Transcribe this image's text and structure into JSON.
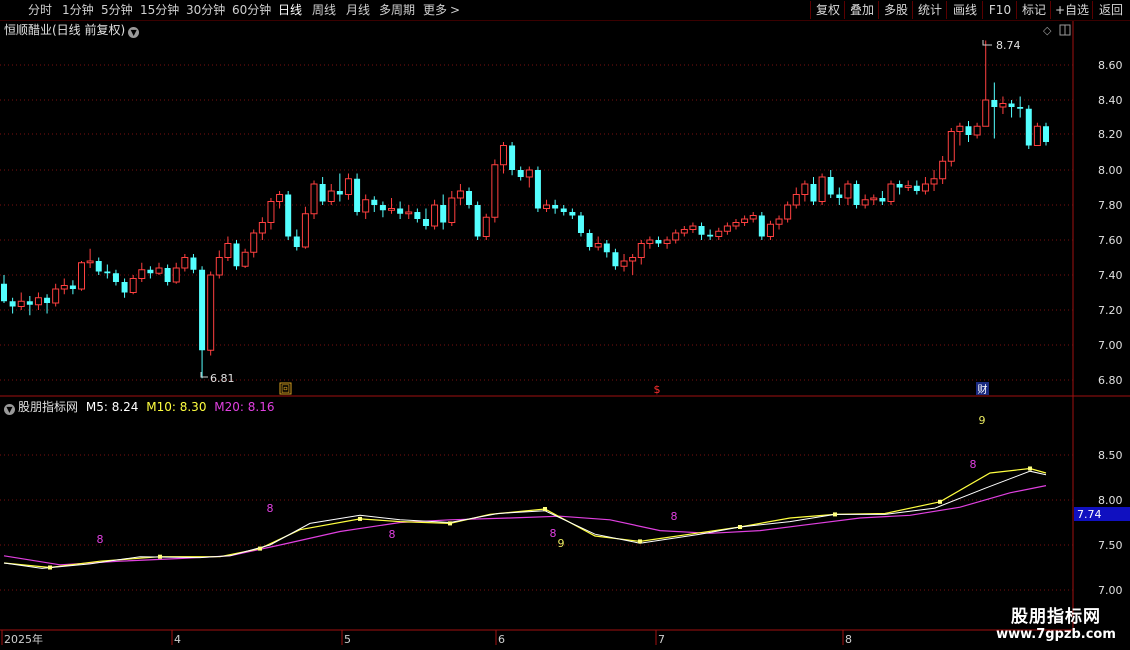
{
  "toolbar": {
    "periods": [
      "分时",
      "1分钟",
      "5分钟",
      "15分钟",
      "30分钟",
      "60分钟",
      "日线",
      "周线",
      "月线",
      "多周期",
      "更多"
    ],
    "selected": "日线",
    "right_buttons": [
      "复权",
      "叠加",
      "多股",
      "统计",
      "画线",
      "F10",
      "标记",
      "+自选",
      "返回"
    ]
  },
  "main_chart": {
    "title": "恒顺醋业(日线 前复权)",
    "y_ticks": [
      "8.60",
      "8.40",
      "8.20",
      "8.00",
      "7.80",
      "7.60",
      "7.40",
      "7.20",
      "7.00",
      "6.80"
    ],
    "high_label": "8.74",
    "low_label": "6.81",
    "markers": [
      "回",
      "$",
      "财"
    ]
  },
  "indicator": {
    "name": "股朋指标网",
    "m5_label": "M5: 8.24",
    "m10_label": "M10: 8.30",
    "m20_label": "M20: 8.16",
    "y_ticks": [
      "8.50",
      "8.00",
      "7.50",
      "7.00"
    ],
    "current_value": "7.74",
    "signals": [
      {
        "text": "8",
        "color": "#e040e0",
        "x": 100,
        "y": 543
      },
      {
        "text": "8",
        "color": "#e040e0",
        "x": 270,
        "y": 512
      },
      {
        "text": "8",
        "color": "#e040e0",
        "x": 392,
        "y": 538
      },
      {
        "text": "8",
        "color": "#e040e0",
        "x": 553,
        "y": 537
      },
      {
        "text": "9",
        "color": "#e8e860",
        "x": 561,
        "y": 547
      },
      {
        "text": "8",
        "color": "#e040e0",
        "x": 674,
        "y": 520
      },
      {
        "text": "8",
        "color": "#e040e0",
        "x": 973,
        "y": 468
      },
      {
        "text": "9",
        "color": "#e8e860",
        "x": 982,
        "y": 424
      }
    ]
  },
  "time_axis": {
    "labels": [
      {
        "text": "2025年",
        "x": 4
      },
      {
        "text": "4",
        "x": 174
      },
      {
        "text": "5",
        "x": 344
      },
      {
        "text": "6",
        "x": 498
      },
      {
        "text": "7",
        "x": 658
      },
      {
        "text": "8",
        "x": 845
      }
    ]
  },
  "watermark": {
    "line1": "股朋指标网",
    "line2": "www.7gpzb.com"
  },
  "colors": {
    "up": "#ff4040",
    "down": "#54ffff",
    "m5": "#ffffff",
    "m10": "#ffff40",
    "m20": "#e040e0",
    "grid": "#7a1010"
  },
  "chart_data": {
    "type": "candlestick",
    "price_range": [
      6.72,
      8.82
    ],
    "candles": [
      [
        7.35,
        7.25,
        7.4,
        7.24
      ],
      [
        7.25,
        7.22,
        7.27,
        7.18
      ],
      [
        7.22,
        7.25,
        7.3,
        7.2
      ],
      [
        7.25,
        7.23,
        7.28,
        7.17
      ],
      [
        7.23,
        7.27,
        7.3,
        7.2
      ],
      [
        7.27,
        7.24,
        7.29,
        7.18
      ],
      [
        7.24,
        7.32,
        7.35,
        7.22
      ],
      [
        7.32,
        7.34,
        7.38,
        7.29
      ],
      [
        7.34,
        7.32,
        7.37,
        7.29
      ],
      [
        7.32,
        7.47,
        7.48,
        7.31
      ],
      [
        7.47,
        7.48,
        7.55,
        7.44
      ],
      [
        7.48,
        7.42,
        7.5,
        7.4
      ],
      [
        7.42,
        7.41,
        7.46,
        7.38
      ],
      [
        7.41,
        7.36,
        7.43,
        7.34
      ],
      [
        7.36,
        7.3,
        7.38,
        7.27
      ],
      [
        7.3,
        7.38,
        7.4,
        7.29
      ],
      [
        7.38,
        7.43,
        7.47,
        7.36
      ],
      [
        7.43,
        7.41,
        7.45,
        7.38
      ],
      [
        7.41,
        7.44,
        7.47,
        7.4
      ],
      [
        7.44,
        7.36,
        7.46,
        7.34
      ],
      [
        7.36,
        7.44,
        7.47,
        7.35
      ],
      [
        7.44,
        7.5,
        7.52,
        7.42
      ],
      [
        7.5,
        7.43,
        7.52,
        7.41
      ],
      [
        7.43,
        6.97,
        7.45,
        6.81
      ],
      [
        6.97,
        7.4,
        7.42,
        6.94
      ],
      [
        7.4,
        7.5,
        7.54,
        7.38
      ],
      [
        7.5,
        7.58,
        7.62,
        7.48
      ],
      [
        7.58,
        7.45,
        7.6,
        7.43
      ],
      [
        7.45,
        7.53,
        7.55,
        7.44
      ],
      [
        7.53,
        7.64,
        7.66,
        7.5
      ],
      [
        7.64,
        7.7,
        7.73,
        7.6
      ],
      [
        7.7,
        7.82,
        7.84,
        7.66
      ],
      [
        7.82,
        7.86,
        7.88,
        7.78
      ],
      [
        7.86,
        7.62,
        7.88,
        7.6
      ],
      [
        7.62,
        7.56,
        7.66,
        7.54
      ],
      [
        7.56,
        7.75,
        7.79,
        7.55
      ],
      [
        7.75,
        7.92,
        7.94,
        7.72
      ],
      [
        7.92,
        7.82,
        7.96,
        7.8
      ],
      [
        7.82,
        7.88,
        7.92,
        7.8
      ],
      [
        7.88,
        7.86,
        7.98,
        7.82
      ],
      [
        7.86,
        7.95,
        7.98,
        7.83
      ],
      [
        7.95,
        7.76,
        7.98,
        7.74
      ],
      [
        7.76,
        7.83,
        7.86,
        7.72
      ],
      [
        7.83,
        7.8,
        7.85,
        7.76
      ],
      [
        7.8,
        7.77,
        7.82,
        7.73
      ],
      [
        7.77,
        7.78,
        7.84,
        7.75
      ],
      [
        7.78,
        7.75,
        7.82,
        7.72
      ],
      [
        7.75,
        7.76,
        7.8,
        7.72
      ],
      [
        7.76,
        7.72,
        7.78,
        7.7
      ],
      [
        7.72,
        7.68,
        7.78,
        7.66
      ],
      [
        7.68,
        7.8,
        7.83,
        7.66
      ],
      [
        7.8,
        7.7,
        7.86,
        7.66
      ],
      [
        7.7,
        7.84,
        7.88,
        7.68
      ],
      [
        7.84,
        7.88,
        7.92,
        7.8
      ],
      [
        7.88,
        7.8,
        7.9,
        7.78
      ],
      [
        7.8,
        7.62,
        7.82,
        7.6
      ],
      [
        7.62,
        7.73,
        7.75,
        7.6
      ],
      [
        7.73,
        8.03,
        8.06,
        7.7
      ],
      [
        8.03,
        8.14,
        8.16,
        7.98
      ],
      [
        8.14,
        8.0,
        8.16,
        7.97
      ],
      [
        8.0,
        7.96,
        8.02,
        7.94
      ],
      [
        7.96,
        8.0,
        8.02,
        7.9
      ],
      [
        8.0,
        7.78,
        8.02,
        7.76
      ],
      [
        7.78,
        7.8,
        7.83,
        7.76
      ],
      [
        7.8,
        7.78,
        7.83,
        7.75
      ],
      [
        7.78,
        7.76,
        7.8,
        7.74
      ],
      [
        7.76,
        7.74,
        7.78,
        7.72
      ],
      [
        7.74,
        7.64,
        7.76,
        7.62
      ],
      [
        7.64,
        7.56,
        7.66,
        7.54
      ],
      [
        7.56,
        7.58,
        7.62,
        7.54
      ],
      [
        7.58,
        7.53,
        7.6,
        7.5
      ],
      [
        7.53,
        7.45,
        7.55,
        7.43
      ],
      [
        7.45,
        7.48,
        7.52,
        7.42
      ],
      [
        7.48,
        7.5,
        7.52,
        7.4
      ],
      [
        7.5,
        7.58,
        7.6,
        7.46
      ],
      [
        7.58,
        7.6,
        7.62,
        7.55
      ],
      [
        7.6,
        7.58,
        7.62,
        7.56
      ],
      [
        7.58,
        7.6,
        7.62,
        7.55
      ],
      [
        7.6,
        7.64,
        7.66,
        7.58
      ],
      [
        7.64,
        7.66,
        7.68,
        7.62
      ],
      [
        7.66,
        7.68,
        7.7,
        7.64
      ],
      [
        7.68,
        7.63,
        7.7,
        7.6
      ],
      [
        7.63,
        7.62,
        7.66,
        7.6
      ],
      [
        7.62,
        7.65,
        7.67,
        7.6
      ],
      [
        7.65,
        7.68,
        7.7,
        7.63
      ],
      [
        7.68,
        7.7,
        7.72,
        7.66
      ],
      [
        7.7,
        7.72,
        7.74,
        7.68
      ],
      [
        7.72,
        7.74,
        7.76,
        7.7
      ],
      [
        7.74,
        7.62,
        7.76,
        7.6
      ],
      [
        7.62,
        7.69,
        7.71,
        7.6
      ],
      [
        7.69,
        7.72,
        7.74,
        7.66
      ],
      [
        7.72,
        7.8,
        7.82,
        7.7
      ],
      [
        7.8,
        7.86,
        7.9,
        7.78
      ],
      [
        7.86,
        7.92,
        7.94,
        7.82
      ],
      [
        7.92,
        7.82,
        7.96,
        7.8
      ],
      [
        7.82,
        7.96,
        7.98,
        7.8
      ],
      [
        7.96,
        7.86,
        8.0,
        7.84
      ],
      [
        7.86,
        7.84,
        7.9,
        7.8
      ],
      [
        7.84,
        7.92,
        7.94,
        7.8
      ],
      [
        7.92,
        7.8,
        7.94,
        7.78
      ],
      [
        7.8,
        7.83,
        7.86,
        7.78
      ],
      [
        7.83,
        7.84,
        7.86,
        7.8
      ],
      [
        7.84,
        7.82,
        7.88,
        7.8
      ],
      [
        7.82,
        7.92,
        7.94,
        7.8
      ],
      [
        7.92,
        7.9,
        7.94,
        7.86
      ],
      [
        7.9,
        7.91,
        7.94,
        7.88
      ],
      [
        7.91,
        7.88,
        7.94,
        7.86
      ],
      [
        7.88,
        7.92,
        7.96,
        7.86
      ],
      [
        7.92,
        7.95,
        8.0,
        7.88
      ],
      [
        7.95,
        8.05,
        8.08,
        7.92
      ],
      [
        8.05,
        8.22,
        8.24,
        8.02
      ],
      [
        8.22,
        8.25,
        8.27,
        8.14
      ],
      [
        8.25,
        8.2,
        8.28,
        8.16
      ],
      [
        8.2,
        8.25,
        8.27,
        8.18
      ],
      [
        8.25,
        8.4,
        8.74,
        8.36
      ],
      [
        8.4,
        8.36,
        8.5,
        8.18
      ],
      [
        8.36,
        8.38,
        8.42,
        8.32
      ],
      [
        8.38,
        8.36,
        8.4,
        8.3
      ],
      [
        8.36,
        8.35,
        8.42,
        8.3
      ],
      [
        8.35,
        8.14,
        8.37,
        8.12
      ],
      [
        8.14,
        8.25,
        8.27,
        8.14
      ],
      [
        8.25,
        8.16,
        8.27,
        8.14
      ]
    ],
    "indicator_range": [
      6.92,
      9.0
    ],
    "m5": [
      [
        4,
        7.3
      ],
      [
        42,
        7.24
      ],
      [
        90,
        7.29
      ],
      [
        140,
        7.37
      ],
      [
        200,
        7.36
      ],
      [
        230,
        7.38
      ],
      [
        270,
        7.5
      ],
      [
        310,
        7.74
      ],
      [
        360,
        7.83
      ],
      [
        400,
        7.78
      ],
      [
        450,
        7.75
      ],
      [
        498,
        7.85
      ],
      [
        545,
        7.88
      ],
      [
        595,
        7.62
      ],
      [
        640,
        7.52
      ],
      [
        700,
        7.62
      ],
      [
        740,
        7.7
      ],
      [
        790,
        7.76
      ],
      [
        835,
        7.84
      ],
      [
        885,
        7.84
      ],
      [
        935,
        7.91
      ],
      [
        985,
        8.13
      ],
      [
        1030,
        8.32
      ],
      [
        1046,
        8.28
      ]
    ],
    "m10": [
      [
        4,
        7.3
      ],
      [
        50,
        7.25
      ],
      [
        100,
        7.32
      ],
      [
        160,
        7.37
      ],
      [
        220,
        7.37
      ],
      [
        260,
        7.46
      ],
      [
        300,
        7.67
      ],
      [
        360,
        7.79
      ],
      [
        400,
        7.76
      ],
      [
        450,
        7.74
      ],
      [
        490,
        7.84
      ],
      [
        545,
        7.9
      ],
      [
        595,
        7.6
      ],
      [
        640,
        7.54
      ],
      [
        690,
        7.62
      ],
      [
        740,
        7.7
      ],
      [
        790,
        7.8
      ],
      [
        835,
        7.84
      ],
      [
        885,
        7.85
      ],
      [
        940,
        7.98
      ],
      [
        990,
        8.3
      ],
      [
        1030,
        8.35
      ],
      [
        1046,
        8.3
      ]
    ],
    "m20": [
      [
        4,
        7.38
      ],
      [
        60,
        7.28
      ],
      [
        120,
        7.32
      ],
      [
        180,
        7.35
      ],
      [
        230,
        7.38
      ],
      [
        280,
        7.5
      ],
      [
        340,
        7.65
      ],
      [
        400,
        7.75
      ],
      [
        450,
        7.78
      ],
      [
        510,
        7.8
      ],
      [
        560,
        7.82
      ],
      [
        610,
        7.78
      ],
      [
        660,
        7.66
      ],
      [
        710,
        7.63
      ],
      [
        760,
        7.66
      ],
      [
        810,
        7.73
      ],
      [
        860,
        7.8
      ],
      [
        910,
        7.83
      ],
      [
        960,
        7.92
      ],
      [
        1010,
        8.08
      ],
      [
        1046,
        8.16
      ]
    ]
  }
}
